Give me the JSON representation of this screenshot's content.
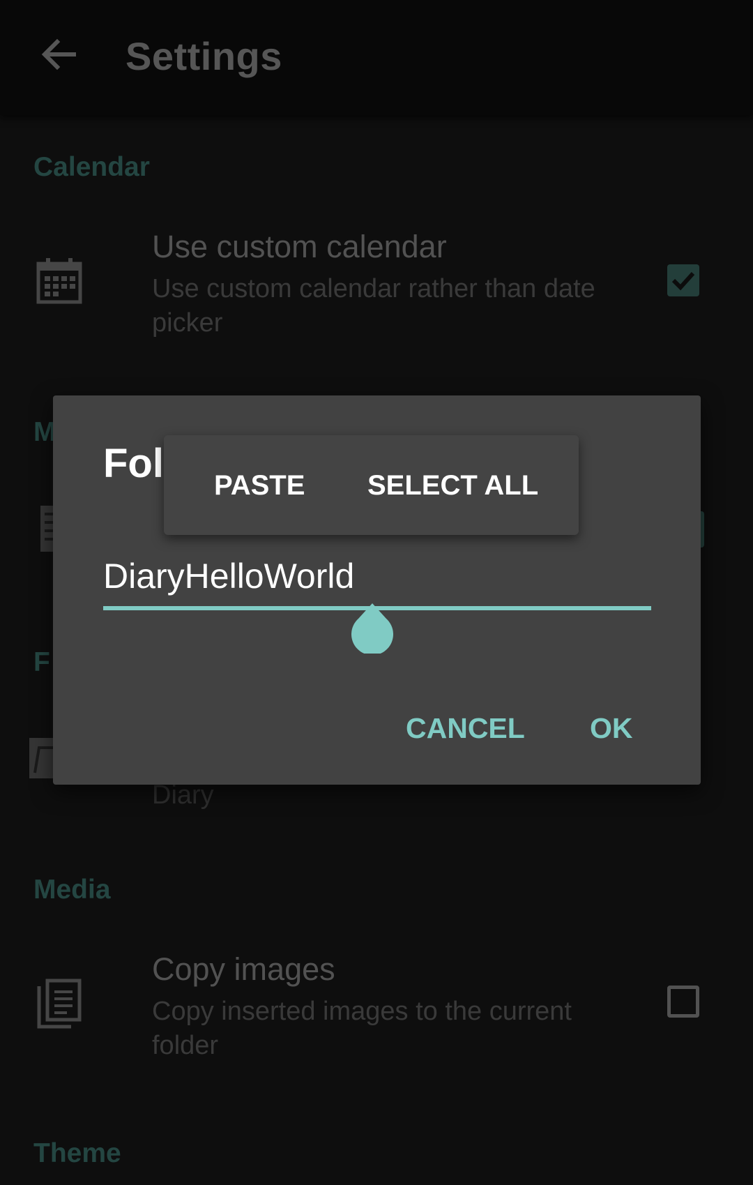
{
  "app_bar": {
    "title": "Settings",
    "back_icon": "arrow-left-icon"
  },
  "sections": {
    "calendar": "Calendar",
    "media": "Media",
    "theme": "Theme"
  },
  "rows": {
    "custom_calendar": {
      "title": "Use custom calendar",
      "subtitle": "Use custom calendar rather than date picker",
      "checked": true,
      "icon": "calendar-icon"
    },
    "copy_images": {
      "title": "Copy images",
      "subtitle": "Copy inserted images to the current folder",
      "checked": false,
      "icon": "copy-icon"
    }
  },
  "dialog": {
    "title": "Fol",
    "input_value": "DiaryHelloWorld",
    "cancel_label": "CANCEL",
    "ok_label": "OK"
  },
  "text_popup": {
    "paste_label": "PASTE",
    "select_all_label": "SELECT ALL"
  },
  "partial_behind": {
    "section_m": "M",
    "section_f": "F",
    "folder_value": "Diary"
  },
  "colors": {
    "accent": "#80cbc4",
    "section_header": "#2f5a55",
    "dialog_bg": "#424242",
    "background": "#121212"
  }
}
